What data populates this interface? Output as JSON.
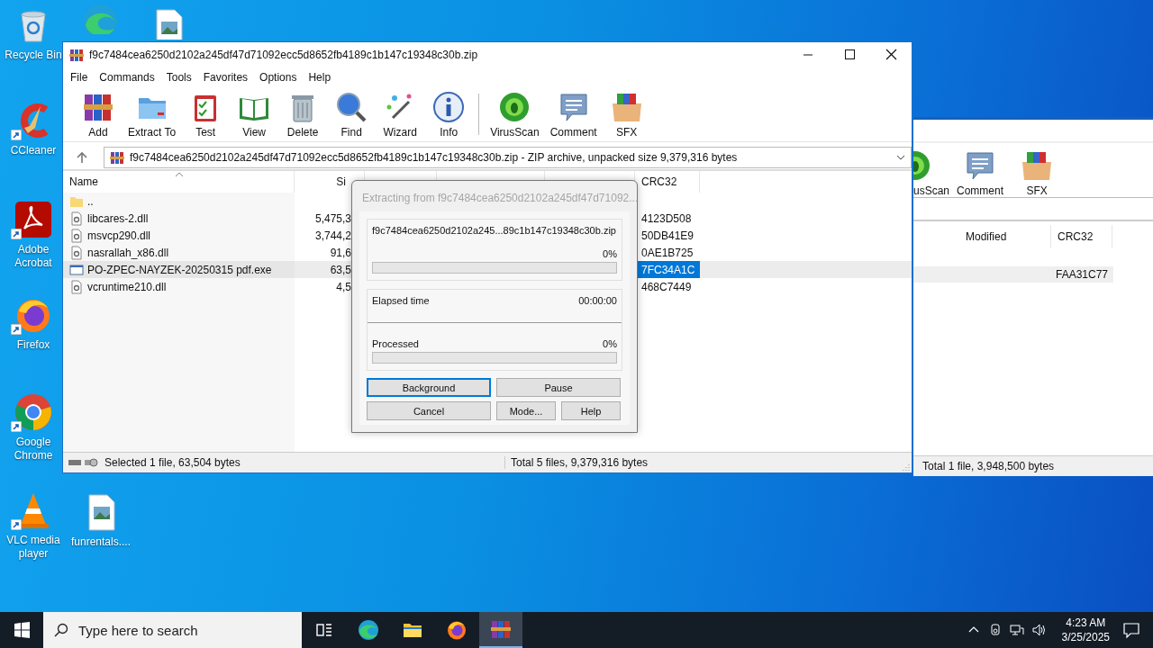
{
  "desktop_icons": [
    {
      "kind": "recycle",
      "label": "Recycle Bin",
      "shortcut": false
    },
    {
      "kind": "edge",
      "shortcut": false
    },
    {
      "kind": "image-file",
      "shortcut": false
    },
    {
      "kind": "ccleaner",
      "label": "CCleaner",
      "shortcut": true
    },
    {
      "kind": "acrobat",
      "label": "Adobe Acrobat",
      "shortcut": true
    },
    {
      "kind": "firefox",
      "label": "Firefox",
      "shortcut": true
    },
    {
      "kind": "chrome",
      "label": "Google Chrome",
      "shortcut": true
    },
    {
      "kind": "vlc",
      "label": "VLC media player",
      "shortcut": true
    },
    {
      "kind": "image-file",
      "label": "funrentals....",
      "shortcut": false
    }
  ],
  "background_window": {
    "toolbar": [
      {
        "kind": "virus",
        "label": "usScan"
      },
      {
        "kind": "comment",
        "label": "Comment"
      },
      {
        "kind": "sfx",
        "label": "SFX"
      }
    ],
    "columns": [
      "Modified",
      "CRC32"
    ],
    "rows": [
      {
        "crc32": "FAA31C77"
      }
    ],
    "status": "Total 1 file, 3,948,500 bytes"
  },
  "window": {
    "title": "f9c7484cea6250d2102a245df47d71092ecc5d8652fb4189c1b147c19348c30b.zip",
    "menu": [
      "File",
      "Commands",
      "Tools",
      "Favorites",
      "Options",
      "Help"
    ],
    "toolbar": [
      {
        "kind": "add",
        "label": "Add"
      },
      {
        "kind": "extract",
        "label": "Extract To"
      },
      {
        "kind": "test",
        "label": "Test"
      },
      {
        "kind": "view",
        "label": "View"
      },
      {
        "kind": "delete",
        "label": "Delete"
      },
      {
        "kind": "find",
        "label": "Find"
      },
      {
        "kind": "wizard",
        "label": "Wizard"
      },
      {
        "kind": "info",
        "label": "Info"
      },
      {
        "kind": "virus",
        "label": "VirusScan"
      },
      {
        "kind": "comment",
        "label": "Comment"
      },
      {
        "kind": "sfx",
        "label": "SFX"
      }
    ],
    "address": "f9c7484cea6250d2102a245df47d71092ecc5d8652fb4189c1b147c19348c30b.zip - ZIP archive, unpacked size 9,379,316 bytes",
    "columns": [
      "Name",
      "Si",
      "CRC32"
    ],
    "files": [
      {
        "kind": "folder",
        "name": "..",
        "selected": false
      },
      {
        "kind": "dll",
        "name": "libcares-2.dll",
        "size": "5,475,3",
        "crc32": "4123D508",
        "selected": false
      },
      {
        "kind": "dll",
        "name": "msvcp290.dll",
        "size": "3,744,2",
        "crc32": "50DB41E9",
        "selected": false
      },
      {
        "kind": "dll",
        "name": "nasrallah_x86.dll",
        "size": "91,6",
        "crc32": "0AE1B725",
        "selected": false
      },
      {
        "kind": "exe",
        "name": "PO-ZPEC-NAYZEK-20250315 pdf.exe",
        "size": "63,5",
        "crc32": "7FC34A1C",
        "selected": true
      },
      {
        "kind": "dll",
        "name": "vcruntime210.dll",
        "size": "4,5",
        "crc32": "468C7449",
        "selected": false
      }
    ],
    "status_left": "Selected 1 file, 63,504 bytes",
    "status_right": "Total 5 files, 9,379,316 bytes"
  },
  "dialog": {
    "title": "Extracting from f9c7484cea6250d2102a245df47d71092...",
    "archive": "f9c7484cea6250d2102a245...89c1b147c19348c30b.zip",
    "archive_percent": "0%",
    "archive_progress": {
      "level": 0
    },
    "elapsed_label": "Elapsed time",
    "elapsed_value": "00:00:00",
    "processed_label": "Processed",
    "processed_percent": "0%",
    "processed_progress": {
      "level": 0
    },
    "buttons": [
      {
        "label": "Background",
        "focused": true
      },
      {
        "label": "Pause",
        "focused": false
      },
      {
        "label": "Cancel",
        "focused": false
      },
      {
        "label": "Mode...",
        "focused": false
      },
      {
        "label": "Help",
        "focused": false
      }
    ]
  },
  "taskbar": {
    "search_placeholder": "Type here to search",
    "apps": [
      {
        "kind": "taskview",
        "active": false
      },
      {
        "kind": "edge",
        "active": false
      },
      {
        "kind": "explorer",
        "active": false
      },
      {
        "kind": "firefox",
        "active": false
      },
      {
        "kind": "winrar",
        "active": true
      }
    ],
    "time": "4:23 AM",
    "date": "3/25/2025"
  }
}
